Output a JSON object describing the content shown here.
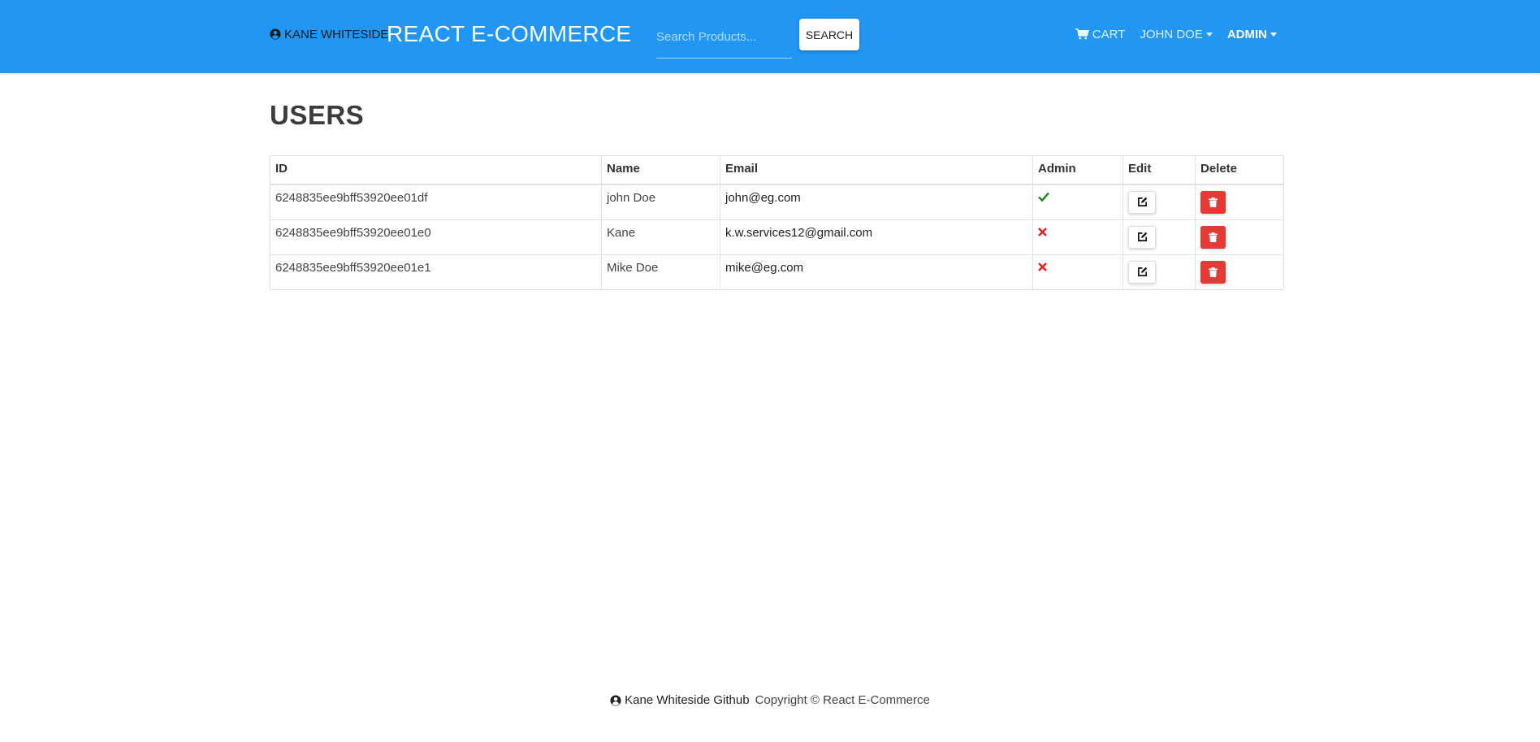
{
  "colors": {
    "navbar": "#2196f3",
    "delete": "#e53935",
    "check": "#1e8e1e",
    "cross": "#e02020"
  },
  "navbar": {
    "user_link": "Kane Whiteside",
    "brand": "React E-Commerce",
    "search_placeholder": "Search Products...",
    "search_button": "Search",
    "cart": "Cart",
    "user_menu": "John Doe",
    "admin_menu": "Admin"
  },
  "page": {
    "title": "Users"
  },
  "table": {
    "headers": {
      "id": "ID",
      "name": "Name",
      "email": "Email",
      "admin": "Admin",
      "edit": "Edit",
      "delete": "Delete"
    },
    "rows": [
      {
        "id": "6248835ee9bff53920ee01df",
        "name": "john Doe",
        "email": "john@eg.com",
        "admin": true,
        "admin_icon": "check-icon"
      },
      {
        "id": "6248835ee9bff53920ee01e0",
        "name": "Kane",
        "email": "k.w.services12@gmail.com",
        "admin": false,
        "admin_icon": "times-icon"
      },
      {
        "id": "6248835ee9bff53920ee01e1",
        "name": "Mike Doe",
        "email": "mike@eg.com",
        "admin": false,
        "admin_icon": "times-icon"
      }
    ]
  },
  "footer": {
    "github_link": "Kane Whiteside Github",
    "copyright": "Copyright © React E-Commerce"
  }
}
